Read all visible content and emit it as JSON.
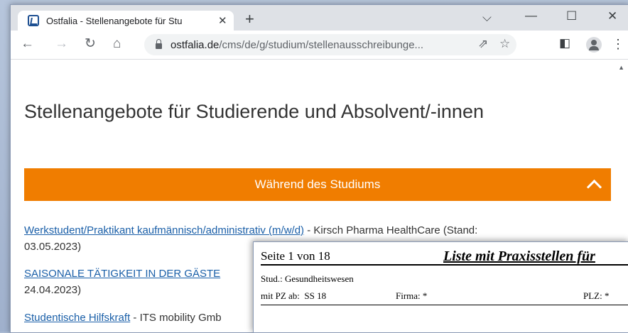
{
  "browser": {
    "tab_title": "Ostfalia - Stellenangebote für Stu",
    "tab_close": "✕",
    "new_tab": "+",
    "url_host": "ostfalia.de",
    "url_path": "/cms/de/g/studium/stellenausschreibunge..."
  },
  "page": {
    "title": "Stellenangebote für Studierende und Absolvent/-innen",
    "section_heading": "Während des Studiums",
    "listings": [
      {
        "link": "Werkstudent/Praktikant kaufmännisch/administrativ (m/w/d)",
        "rest": " - Kirsch Pharma HealthCare (Stand:",
        "line2": "03.05.2023)"
      },
      {
        "link": "SAISONALE TÄTIGKEIT IN DER GÄSTE",
        "rest": "",
        "line2": "24.04.2023)"
      },
      {
        "link": "Studentische Hilfskraft",
        "rest": " - ITS mobility Gmb",
        "line2": ""
      }
    ]
  },
  "pdf": {
    "page_label": "Seite 1 von 18",
    "title": "Liste mit Praxisstellen für",
    "stud_label": "Stud.:",
    "stud_value": "Gesundheitswesen",
    "pz_label": "mit PZ ab:",
    "pz_value": "SS 18",
    "firma_label": "Firma: *",
    "plz_label": "PLZ: *"
  },
  "colors": {
    "accent_orange": "#f07d00",
    "link_blue": "#1a5fa8"
  }
}
